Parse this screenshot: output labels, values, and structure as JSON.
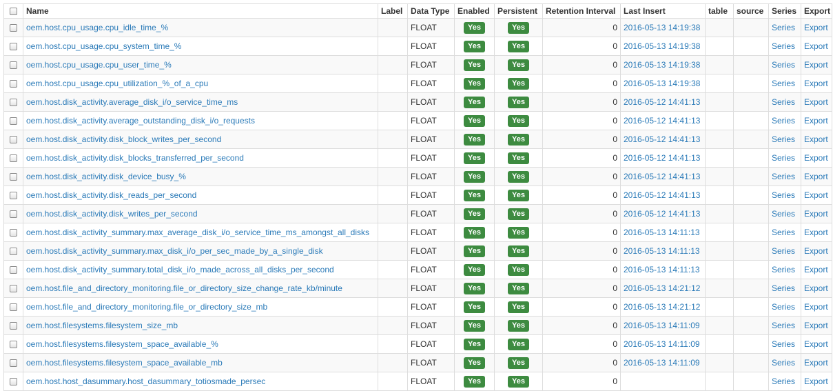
{
  "table": {
    "headers": {
      "name": "Name",
      "label": "Label",
      "data_type": "Data Type",
      "enabled": "Enabled",
      "persistent": "Persistent",
      "retention": "Retention Interval",
      "last_insert": "Last Insert",
      "table": "table",
      "source": "source",
      "series": "Series",
      "export": "Export"
    },
    "rows": [
      {
        "name": "oem.host.cpu_usage.cpu_idle_time_%",
        "label": "",
        "data_type": "FLOAT",
        "enabled": "Yes",
        "persistent": "Yes",
        "retention": "0",
        "last_insert": "2016-05-13 14:19:38",
        "table": "",
        "source": "",
        "series": "Series",
        "export": "Export"
      },
      {
        "name": "oem.host.cpu_usage.cpu_system_time_%",
        "label": "",
        "data_type": "FLOAT",
        "enabled": "Yes",
        "persistent": "Yes",
        "retention": "0",
        "last_insert": "2016-05-13 14:19:38",
        "table": "",
        "source": "",
        "series": "Series",
        "export": "Export"
      },
      {
        "name": "oem.host.cpu_usage.cpu_user_time_%",
        "label": "",
        "data_type": "FLOAT",
        "enabled": "Yes",
        "persistent": "Yes",
        "retention": "0",
        "last_insert": "2016-05-13 14:19:38",
        "table": "",
        "source": "",
        "series": "Series",
        "export": "Export"
      },
      {
        "name": "oem.host.cpu_usage.cpu_utilization_%_of_a_cpu",
        "label": "",
        "data_type": "FLOAT",
        "enabled": "Yes",
        "persistent": "Yes",
        "retention": "0",
        "last_insert": "2016-05-13 14:19:38",
        "table": "",
        "source": "",
        "series": "Series",
        "export": "Export"
      },
      {
        "name": "oem.host.disk_activity.average_disk_i/o_service_time_ms",
        "label": "",
        "data_type": "FLOAT",
        "enabled": "Yes",
        "persistent": "Yes",
        "retention": "0",
        "last_insert": "2016-05-12 14:41:13",
        "table": "",
        "source": "",
        "series": "Series",
        "export": "Export"
      },
      {
        "name": "oem.host.disk_activity.average_outstanding_disk_i/o_requests",
        "label": "",
        "data_type": "FLOAT",
        "enabled": "Yes",
        "persistent": "Yes",
        "retention": "0",
        "last_insert": "2016-05-12 14:41:13",
        "table": "",
        "source": "",
        "series": "Series",
        "export": "Export"
      },
      {
        "name": "oem.host.disk_activity.disk_block_writes_per_second",
        "label": "",
        "data_type": "FLOAT",
        "enabled": "Yes",
        "persistent": "Yes",
        "retention": "0",
        "last_insert": "2016-05-12 14:41:13",
        "table": "",
        "source": "",
        "series": "Series",
        "export": "Export"
      },
      {
        "name": "oem.host.disk_activity.disk_blocks_transferred_per_second",
        "label": "",
        "data_type": "FLOAT",
        "enabled": "Yes",
        "persistent": "Yes",
        "retention": "0",
        "last_insert": "2016-05-12 14:41:13",
        "table": "",
        "source": "",
        "series": "Series",
        "export": "Export"
      },
      {
        "name": "oem.host.disk_activity.disk_device_busy_%",
        "label": "",
        "data_type": "FLOAT",
        "enabled": "Yes",
        "persistent": "Yes",
        "retention": "0",
        "last_insert": "2016-05-12 14:41:13",
        "table": "",
        "source": "",
        "series": "Series",
        "export": "Export"
      },
      {
        "name": "oem.host.disk_activity.disk_reads_per_second",
        "label": "",
        "data_type": "FLOAT",
        "enabled": "Yes",
        "persistent": "Yes",
        "retention": "0",
        "last_insert": "2016-05-12 14:41:13",
        "table": "",
        "source": "",
        "series": "Series",
        "export": "Export"
      },
      {
        "name": "oem.host.disk_activity.disk_writes_per_second",
        "label": "",
        "data_type": "FLOAT",
        "enabled": "Yes",
        "persistent": "Yes",
        "retention": "0",
        "last_insert": "2016-05-12 14:41:13",
        "table": "",
        "source": "",
        "series": "Series",
        "export": "Export"
      },
      {
        "name": "oem.host.disk_activity_summary.max_average_disk_i/o_service_time_ms_amongst_all_disks",
        "label": "",
        "data_type": "FLOAT",
        "enabled": "Yes",
        "persistent": "Yes",
        "retention": "0",
        "last_insert": "2016-05-13 14:11:13",
        "table": "",
        "source": "",
        "series": "Series",
        "export": "Export"
      },
      {
        "name": "oem.host.disk_activity_summary.max_disk_i/o_per_sec_made_by_a_single_disk",
        "label": "",
        "data_type": "FLOAT",
        "enabled": "Yes",
        "persistent": "Yes",
        "retention": "0",
        "last_insert": "2016-05-13 14:11:13",
        "table": "",
        "source": "",
        "series": "Series",
        "export": "Export"
      },
      {
        "name": "oem.host.disk_activity_summary.total_disk_i/o_made_across_all_disks_per_second",
        "label": "",
        "data_type": "FLOAT",
        "enabled": "Yes",
        "persistent": "Yes",
        "retention": "0",
        "last_insert": "2016-05-13 14:11:13",
        "table": "",
        "source": "",
        "series": "Series",
        "export": "Export"
      },
      {
        "name": "oem.host.file_and_directory_monitoring.file_or_directory_size_change_rate_kb/minute",
        "label": "",
        "data_type": "FLOAT",
        "enabled": "Yes",
        "persistent": "Yes",
        "retention": "0",
        "last_insert": "2016-05-13 14:21:12",
        "table": "",
        "source": "",
        "series": "Series",
        "export": "Export"
      },
      {
        "name": "oem.host.file_and_directory_monitoring.file_or_directory_size_mb",
        "label": "",
        "data_type": "FLOAT",
        "enabled": "Yes",
        "persistent": "Yes",
        "retention": "0",
        "last_insert": "2016-05-13 14:21:12",
        "table": "",
        "source": "",
        "series": "Series",
        "export": "Export"
      },
      {
        "name": "oem.host.filesystems.filesystem_size_mb",
        "label": "",
        "data_type": "FLOAT",
        "enabled": "Yes",
        "persistent": "Yes",
        "retention": "0",
        "last_insert": "2016-05-13 14:11:09",
        "table": "",
        "source": "",
        "series": "Series",
        "export": "Export"
      },
      {
        "name": "oem.host.filesystems.filesystem_space_available_%",
        "label": "",
        "data_type": "FLOAT",
        "enabled": "Yes",
        "persistent": "Yes",
        "retention": "0",
        "last_insert": "2016-05-13 14:11:09",
        "table": "",
        "source": "",
        "series": "Series",
        "export": "Export"
      },
      {
        "name": "oem.host.filesystems.filesystem_space_available_mb",
        "label": "",
        "data_type": "FLOAT",
        "enabled": "Yes",
        "persistent": "Yes",
        "retention": "0",
        "last_insert": "2016-05-13 14:11:09",
        "table": "",
        "source": "",
        "series": "Series",
        "export": "Export"
      },
      {
        "name": "oem.host.host_dasummary.host_dasummary_totiosmade_persec",
        "label": "",
        "data_type": "FLOAT",
        "enabled": "Yes",
        "persistent": "Yes",
        "retention": "0",
        "last_insert": "",
        "table": "",
        "source": "",
        "series": "Series",
        "export": "Export"
      }
    ]
  },
  "colors": {
    "link": "#2a7ab8",
    "badge_green": "#3d8b40",
    "row_stripe": "#f9f9f9",
    "border": "#dddddd"
  }
}
